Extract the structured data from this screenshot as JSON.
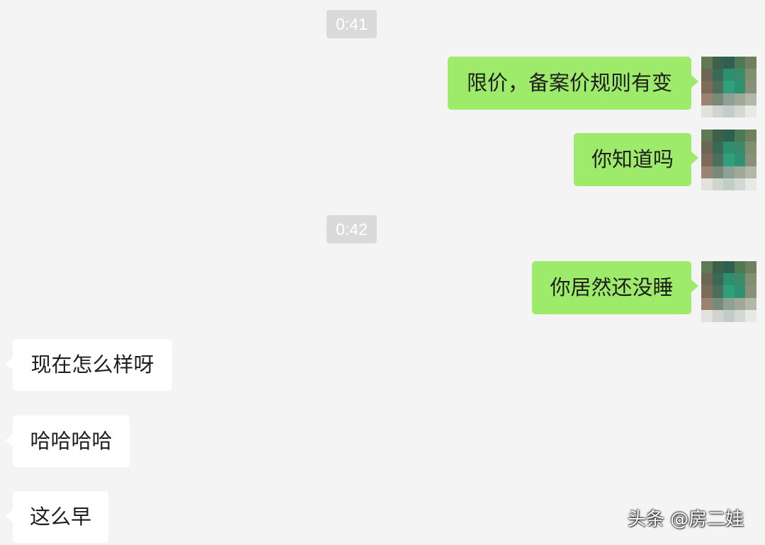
{
  "colors": {
    "background": "#f4f4f4",
    "outgoing_bubble": "#9eea6a",
    "incoming_bubble": "#ffffff",
    "timestamp_bg": "#dadada"
  },
  "timestamps": [
    "0:41",
    "0:42"
  ],
  "outgoing": [
    {
      "text": "限价，备案价规则有变",
      "avatar_icon": "pixelated-avatar-icon"
    },
    {
      "text": "你知道吗",
      "avatar_icon": "pixelated-avatar-icon"
    },
    {
      "text": "你居然还没睡",
      "avatar_icon": "pixelated-avatar-icon"
    }
  ],
  "incoming": [
    {
      "text": "现在怎么样呀"
    },
    {
      "text": "哈哈哈哈"
    },
    {
      "text": "这么早"
    }
  ],
  "watermark": "头条 @房二娃"
}
